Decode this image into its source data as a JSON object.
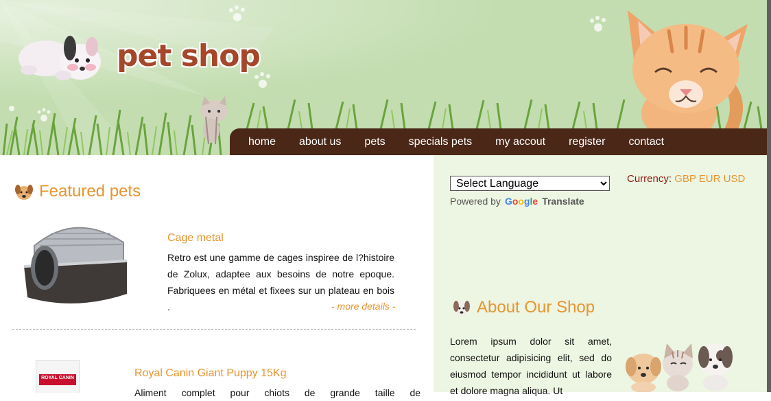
{
  "logo": {
    "text": "pet shop"
  },
  "nav": {
    "items": [
      {
        "label": "home"
      },
      {
        "label": "about us"
      },
      {
        "label": "pets"
      },
      {
        "label": "specials pets"
      },
      {
        "label": "my accout"
      },
      {
        "label": "register"
      },
      {
        "label": "contact"
      }
    ]
  },
  "featured": {
    "title": "Featured pets",
    "products": [
      {
        "name": "Cage metal",
        "description": "Retro est une gamme de cages inspiree de l?histoire de Zolux, adaptee aux besoins de notre epoque. Fabriquees en métal et fixees sur un plateau en bois .",
        "more": "- more details -"
      },
      {
        "name": "Royal Canin Giant Puppy 15Kg",
        "description": "Aliment complet pour chiots de grande taille de",
        "image_label": "ROYAL CANIN"
      }
    ]
  },
  "sidebar": {
    "language": {
      "selected": "Select Language",
      "powered_by": "Powered by",
      "google": "Google",
      "translate": "Translate"
    },
    "currency": {
      "label": "Currency:",
      "options": [
        "GBP",
        "EUR",
        "USD"
      ]
    },
    "about": {
      "title": "About Our Shop",
      "text": "Lorem ipsum dolor sit amet, consectetur adipisicing elit, sed do eiusmod tempor incididunt ut labore et dolore magna aliqua. Ut"
    }
  },
  "colors": {
    "accent": "#e8952e",
    "nav_bg": "#4a2717",
    "header_bg": "#c3ddb0",
    "sidebar_bg": "#edf5e3",
    "logo": "#a5472a"
  }
}
